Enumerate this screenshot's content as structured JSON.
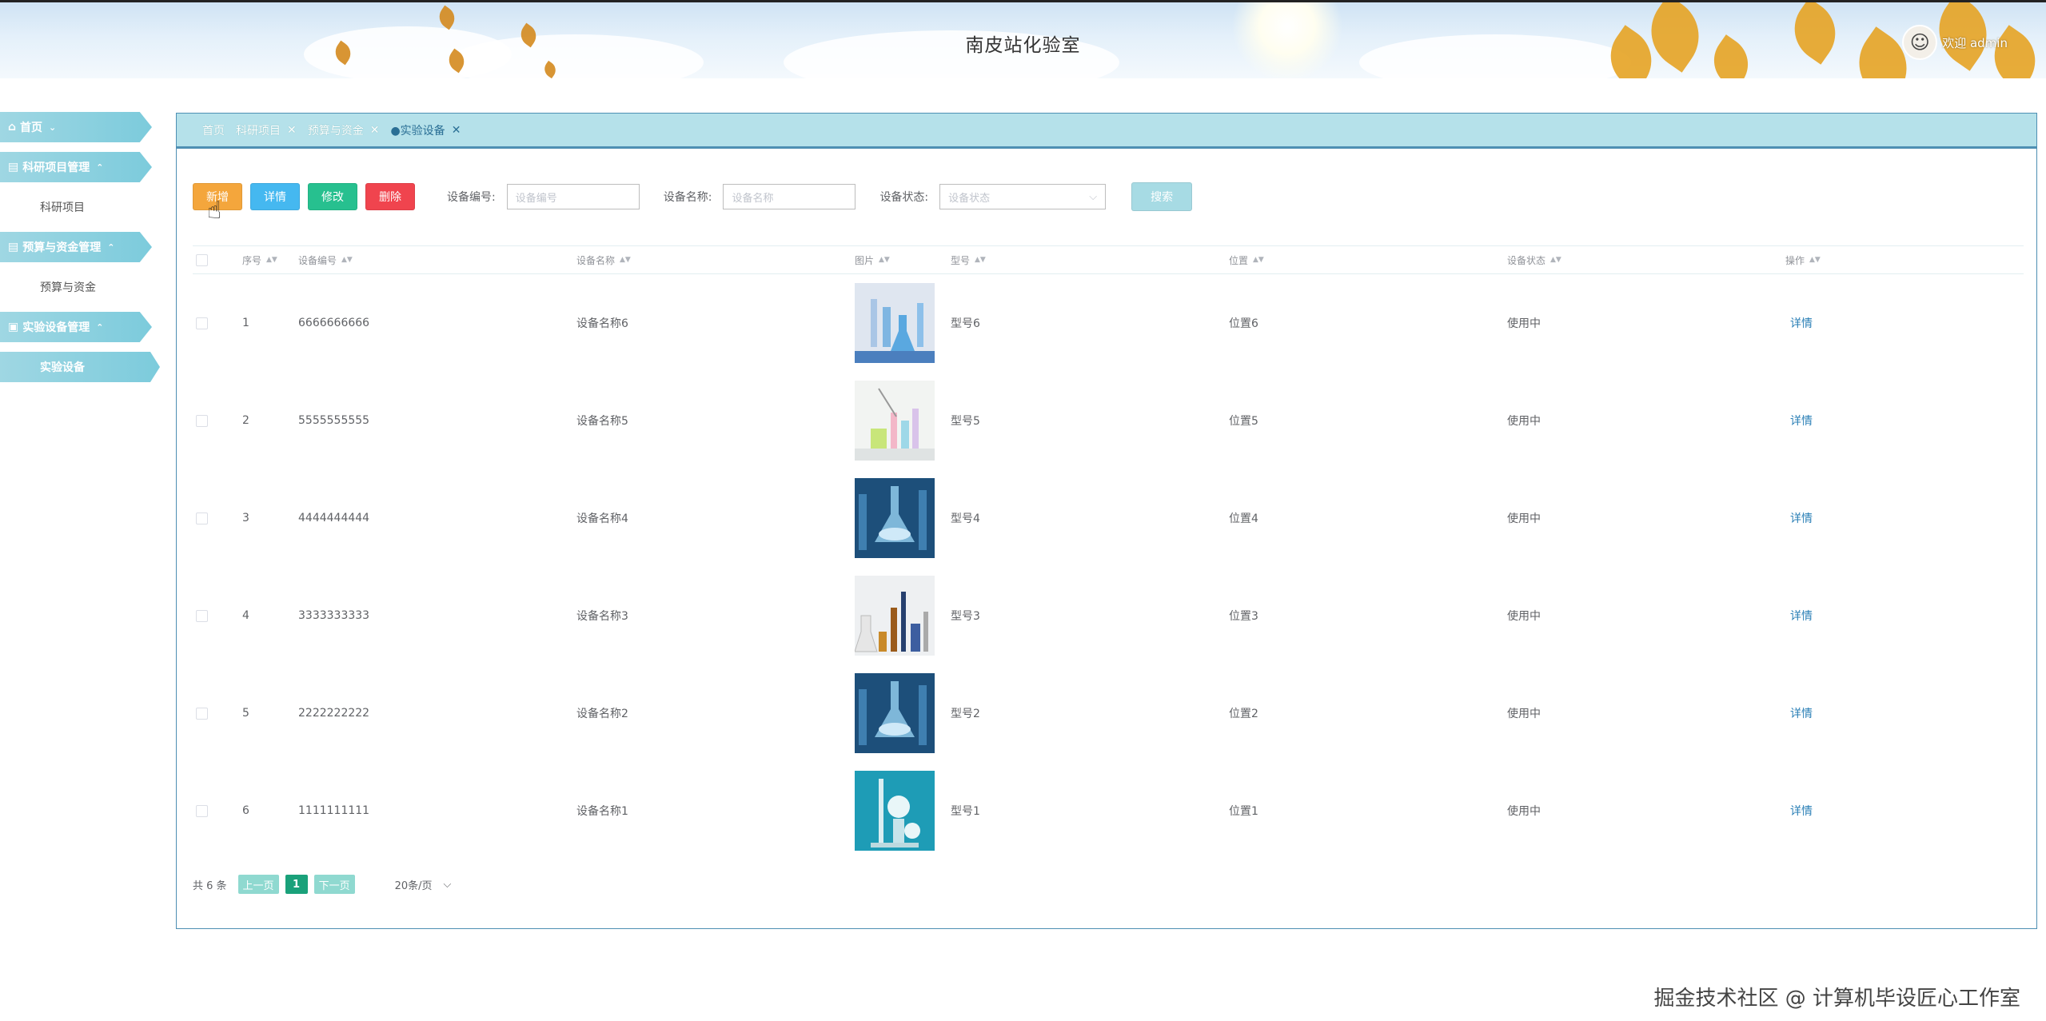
{
  "header": {
    "title": "南皮站化验室",
    "welcome": "欢迎 admin"
  },
  "sidebar": {
    "items": [
      {
        "label": "首页",
        "type": "group",
        "icon": "home-icon",
        "chevron": "⌄"
      },
      {
        "label": "科研项目管理",
        "type": "group",
        "icon": "menu-icon",
        "chevron": "⌃"
      },
      {
        "label": "科研项目",
        "type": "sub"
      },
      {
        "label": "预算与资金管理",
        "type": "group",
        "icon": "menu-icon",
        "chevron": "⌃"
      },
      {
        "label": "预算与资金",
        "type": "sub"
      },
      {
        "label": "实验设备管理",
        "type": "group",
        "icon": "briefcase-icon",
        "chevron": "⌃"
      },
      {
        "label": "实验设备",
        "type": "sub",
        "active": true
      }
    ]
  },
  "tabs": [
    {
      "label": "首页",
      "closable": false
    },
    {
      "label": "科研项目",
      "closable": true
    },
    {
      "label": "预算与资金",
      "closable": true
    },
    {
      "label": "●实验设备",
      "closable": true,
      "active": true
    }
  ],
  "toolbar": {
    "add": "新增",
    "detail": "详情",
    "edit": "修改",
    "delete": "删除"
  },
  "search": {
    "code_label": "设备编号:",
    "code_placeholder": "设备编号",
    "name_label": "设备名称:",
    "name_placeholder": "设备名称",
    "status_label": "设备状态:",
    "status_placeholder": "设备状态",
    "button": "搜索"
  },
  "table": {
    "columns": [
      "序号",
      "设备编号",
      "设备名称",
      "图片",
      "型号",
      "位置",
      "设备状态",
      "操作"
    ],
    "rows": [
      {
        "index": "1",
        "code": "6666666666",
        "name": "设备名称6",
        "image": "lab-glassware-image",
        "model": "型号6",
        "location": "位置6",
        "status": "使用中",
        "action": "详情"
      },
      {
        "index": "2",
        "code": "5555555555",
        "name": "设备名称5",
        "image": "lab-glassware-image",
        "model": "型号5",
        "location": "位置5",
        "status": "使用中",
        "action": "详情"
      },
      {
        "index": "3",
        "code": "4444444444",
        "name": "设备名称4",
        "image": "blue-flask-image",
        "model": "型号4",
        "location": "位置4",
        "status": "使用中",
        "action": "详情"
      },
      {
        "index": "4",
        "code": "3333333333",
        "name": "设备名称3",
        "image": "lab-glassware-image",
        "model": "型号3",
        "location": "位置3",
        "status": "使用中",
        "action": "详情"
      },
      {
        "index": "5",
        "code": "2222222222",
        "name": "设备名称2",
        "image": "blue-flask-image",
        "model": "型号2",
        "location": "位置2",
        "status": "使用中",
        "action": "详情"
      },
      {
        "index": "6",
        "code": "1111111111",
        "name": "设备名称1",
        "image": "lab-apparatus-image",
        "model": "型号1",
        "location": "位置1",
        "status": "使用中",
        "action": "详情"
      }
    ]
  },
  "pagination": {
    "total": "共 6 条",
    "prev": "上一页",
    "page": "1",
    "next": "下一页",
    "page_size": "20条/页"
  },
  "watermark": "掘金技术社区 @ 计算机毕设匠心工作室",
  "colors": {
    "accent": "#7ccbdc",
    "tab_bar": "#b5e1ea",
    "border": "#4e8fb3",
    "add": "#f4a63c",
    "detail": "#45b8f0",
    "edit": "#27c08f",
    "delete": "#f0444e",
    "search": "#a7dbe4",
    "link": "#2a7fb6"
  }
}
